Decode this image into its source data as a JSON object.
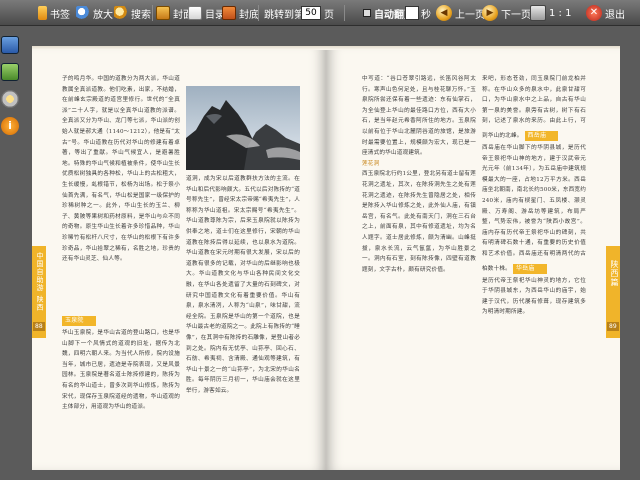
{
  "toolbar": {
    "bookmark_label": "书签",
    "zoom_label": "放大",
    "search_label": "搜索",
    "cover_label": "封面",
    "toc_label": "目录",
    "back_cover_label": "封底",
    "jump_prefix": "跳转到第",
    "page_value": "50",
    "jump_suffix": "页",
    "autoflip_label": "自动翻页",
    "seconds_label": "秒",
    "prev_label": "上一页",
    "next_label": "下一页",
    "zoom_ratio": "1 : 1",
    "exit_label": "退出"
  },
  "book": {
    "left": {
      "col1_text": "子的鸣月华。中国的道教分为两大派，华山道教属全真派道教。他们吃素，出家，不结婚，在前峰玄宗殿道的道宫里修行。世代的“全真派”二十人字，就是以全真华山道教的派谱。全真派又分为华山、龙门等七派，华山派的创始人就是郝大通（1140～1212），他是有“太古”号。华山道教在历代对华山的修建有着卓著，等出了重献。华山气候宜人，是避暑胜地。特殊的华山气候和植被条件，使华山生长优质松树独具的各种松，华山上的古松粗大，生长缓慢，虬根错节，松杨为出场。松于祭小仙首先满，有名气，华山松是国家一级保护的珍稀树种之一。此外，华山生长的玉兰、柳子、黄陂等果树和药材原料，是华山与众不同的奇物。原生华山生长着许多珍惜品种，华山珍稀竹有松杆八尺寸，在华山的松根下有许多珍奇品，华山拾翠之稀有，名胜之地，珍贵的还有华山灵芝、仙人等。",
      "subhead1": "玉泉院",
      "col1_bottom": "华山玉泉院，是华山古道的登山路口，也是华山脚下一个风情式的道观的旧址，据传为北魏，四明六朝人来。为当代人所修，院内设施当年，城市已居，遗迹是寺院表现，又是风景园林。玉泉院是著名道士陈抟修建的，陈抟为有名的华山道士，曾多次到华山修炼，陈抟为宋代，现保存玉泉院道经的遗物，华山道观的主体部分，用道观为华山的道派。",
      "col2_text": "道洞，成为宋以后道教群扶方法的主流。在华山和后代影响颇大。五代以后对陈抟的“道号称先生”，曾经宋太宗帝赐“希夷先生”，人称称为华山道祖。宋太宗赐号“希夷先生”。华山道教尊陈为宗，后来玉泉院就以陈抟为供奉之地，道士们在这里修行，宋朝的华山道教在陈抟后得以延续，也以泉水为道院。华山道教在宋元时期有很大发展，宋以后的道教有很多的记载，对华山的后继影响也极大。华山道教文化与华山各种民间文化交融，在华山各处遗留了大量的石刻碑文，对研究中国道教文化有着重要价值。华山有泉，泉水清冽，人称为“山泉”，味甘甜，流经全院。玉泉院是华山的第一个道院，也是华山最古老的道院之一。此院上有陈抟的“睡像”，在其洞中有陈抟的石雕像，是登山者必到之处。院内有无忧亭、山荪亭、回心石、石舫、希夷祠、含清殿、通仙观等建筑，有华山十景之一的“山荪亭”，为北宋的华山名胜。每年阴历三月初一，华山庙会就在这里举行，游客如云。",
      "tab_text": "中国自助游 陕西",
      "page_num": "88"
    },
    "right": {
      "col1_text": "中写道：“谷口苍翠引路远，长笛风谷阿太行。寒声山色何足处，且与桂花聊万怀。”玉泉院所尝还保有着一些遗迹：东有仙掌石，为全仙登上华山的最佳路口方位，西有大小石，是当年赵元希香阿所住的地方。玉泉院以前有位于华山北麓阴谷道的旅馆，是旅游时最需要位置上，规模颇为宏大，现已是一座清式的华山道观建筑。",
      "subhead1": "莲花洞",
      "col1_more": "西玉泉院北行约1公里，登北另有道士留有莲花洞之遗址，其次，在陈抟洞先生之处有莲花洞之遗迹，在陈抟先生曾隐居之处，相传是陈抟入华山修炼之处，此外仙人庙，有镇岳宫，有名气。此处有南天门，洞在三石台之上，前面有泉，其中有修道遗址，均为名人题字。道士居此修炼，颇为清幽。山峰挺拔，泉水长流，云气氤氲，为华山胜景之一。洞内有石室，刻有陈抟像，四壁有道教题刻，文字古朴，颇有研究价值。",
      "col2_text": "来吧，形态苍劲，同玉泉院门前龙柏并称。在华山众多的泉水中，此泉甘甜可口，为华山泉水中之上品，自古有华山第一泉的美誉。泉旁有古树，树下有石刻，记述了泉水的来历。由此上行，可到华山的北峰。",
      "subhead2": "西岳庙",
      "col2_more": "西岳庙在华山脚下的华阴县城，是历代帝王祭祀华山神的地方，建于汉武帝元光元年（前134年），为五岳庙中建筑规模最大的一座，占地12万平方米。西岳庙坐北朝南，南北长约500米，东西宽约240米，庙内有棂星门、五凤楼、灏灵殿、万寿阁、游岳坊等建筑，布局严整，气势宏伟，被誉为“陕西小故宫”。庙内存有历代帝王祭祀华山的碑刻，共有明清碑石数十通，有重要的历史价值和艺术价值。西岳庙还有明清两代的古柏数十株。",
      "subhead3": "华岳庙",
      "col2_end": "是历代帝王祭祀华山神灵的地方，它位于华阴县城东，为西岳华山的庙宇，始建于汉代，历代屡有修葺，现存建筑多为明清时期所建。",
      "tab_text": "陕西篇",
      "page_num": "89"
    }
  }
}
